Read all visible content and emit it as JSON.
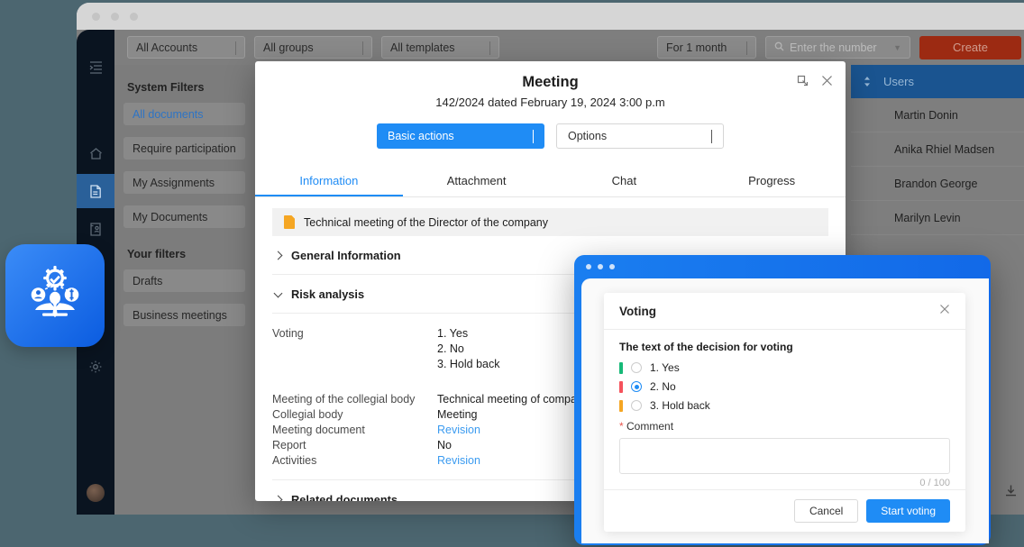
{
  "app": {
    "background_color": "#4c6670",
    "accent_blue": "#1f8cf5",
    "create_red": "#9c2a12",
    "rail_dark": "#0a1420"
  },
  "toolbar": {
    "accounts": "All Accounts",
    "groups": "All groups",
    "templates": "All templates",
    "period": "For 1 month",
    "search_placeholder": "Enter the number",
    "create_label": "Create"
  },
  "sidebar": {
    "rail_icons": [
      "menu-list-icon",
      "home-icon",
      "document-icon",
      "contract-icon",
      "calendar-icon",
      "gear-icon",
      "avatar"
    ],
    "system_filters_title": "System Filters",
    "system_filters": [
      {
        "label": "All documents",
        "selected": true
      },
      {
        "label": "Require participation",
        "selected": false
      },
      {
        "label": "My Assignments",
        "selected": false
      },
      {
        "label": "My Documents",
        "selected": false
      }
    ],
    "your_filters_title": "Your filters",
    "your_filters": [
      {
        "label": "Drafts"
      },
      {
        "label": "Business meetings"
      }
    ]
  },
  "users_table": {
    "header": "Users",
    "rows": [
      "Martin Donin",
      "Anika Rhiel Madsen",
      "Brandon George",
      "Marilyn Levin"
    ]
  },
  "meeting": {
    "title": "Meeting",
    "subtitle": "142/2024 dated February 19, 2024 3:00 p.m",
    "expand_icon": "expand-icon",
    "close_icon": "close-icon",
    "basic_actions": "Basic actions",
    "options": "Options",
    "tabs": [
      {
        "label": "Information",
        "active": true
      },
      {
        "label": "Attachment",
        "active": false
      },
      {
        "label": "Chat",
        "active": false
      },
      {
        "label": "Progress",
        "active": false
      }
    ],
    "doc_bar": "Technical meeting of the Director of the company",
    "section_general": "General Information",
    "section_risk": "Risk analysis",
    "section_related": "Related documents",
    "voting_label": "Voting",
    "voting_options": [
      "1. Yes",
      "2. No",
      "3. Hold back"
    ],
    "fields": [
      {
        "key": "Meeting of the collegial body",
        "value": "Technical meeting of compan",
        "link": false
      },
      {
        "key": "Collegial body",
        "value": "Meeting",
        "link": false
      },
      {
        "key": "Meeting document",
        "value": "Revision",
        "link": true
      },
      {
        "key": "Report",
        "value": "No",
        "link": false
      },
      {
        "key": "Activities",
        "value": "Revision",
        "link": true
      }
    ]
  },
  "voting_dialog": {
    "title": "Voting",
    "close_icon": "close-icon",
    "question": "The text of the decision for voting",
    "options": [
      {
        "label": "1. Yes",
        "color": "#17b978",
        "selected": false
      },
      {
        "label": "2. No",
        "color": "#f5525c",
        "selected": true
      },
      {
        "label": "3. Hold back",
        "color": "#f5a623",
        "selected": false
      }
    ],
    "comment_label": "Comment",
    "comment_required": "*",
    "comment_value": "",
    "char_count": "0 / 100",
    "cancel_label": "Cancel",
    "submit_label": "Start voting"
  }
}
